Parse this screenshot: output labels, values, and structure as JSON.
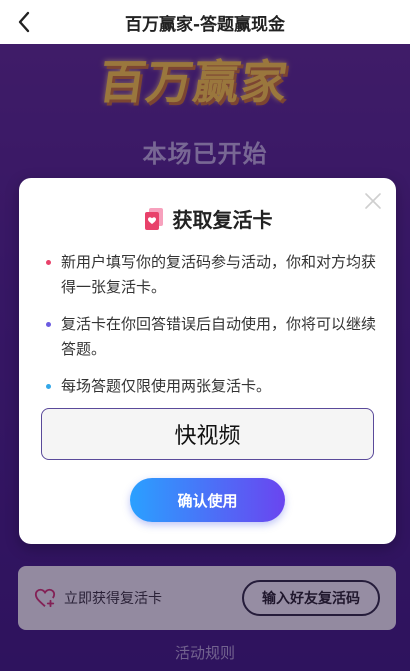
{
  "header": {
    "title": "百万赢家-答题赢现金"
  },
  "background": {
    "logo_text": "百万赢家",
    "status_text": "本场已开始",
    "revive_label": "立即获得复活卡",
    "invite_button": "输入好友复活码",
    "rules_link": "活动规则"
  },
  "modal": {
    "title": "获取复活卡",
    "bullets": [
      {
        "text": "新用户填写你的复活码参与活动，你和对方均获得一张复活卡。",
        "color": "#e8416a"
      },
      {
        "text": "复活卡在你回答错误后自动使用，你将可以继续答题。",
        "color": "#6b5be0"
      },
      {
        "text": "每场答题仅限使用两张复活卡。",
        "color": "#33a7e8"
      }
    ],
    "input_value": "快视频",
    "confirm_button": "确认使用"
  },
  "colors": {
    "accent_start": "#2aa0ff",
    "accent_end": "#6a45f0",
    "bg_purple": "#4a2186"
  }
}
